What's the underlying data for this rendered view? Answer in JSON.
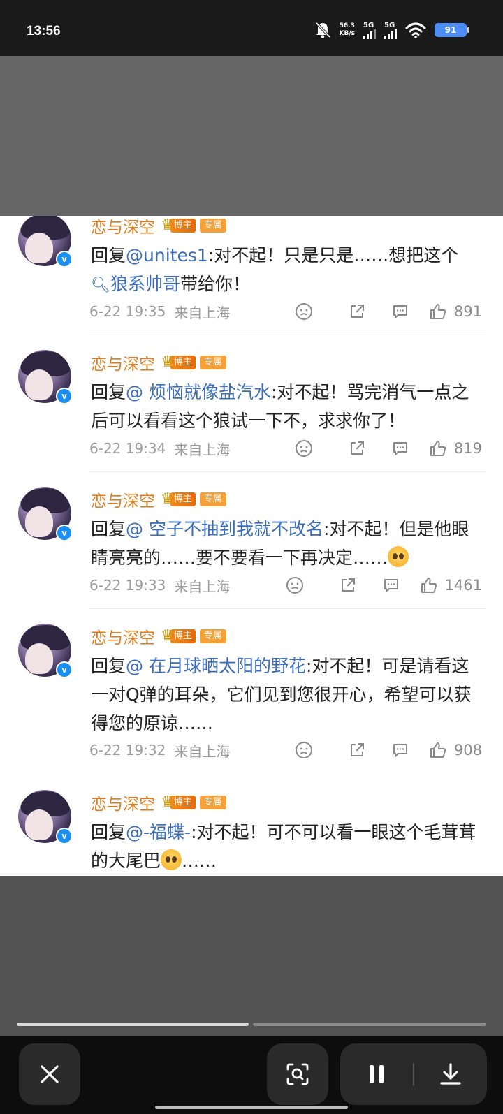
{
  "status_bar": {
    "time": "13:56",
    "net_speed_value": "56.3",
    "net_speed_unit": "KB/s",
    "sim1": "5G",
    "sim2": "5G",
    "battery": "91",
    "icons": [
      "bell-muted-icon",
      "signal-icon",
      "signal-icon",
      "wifi-icon",
      "battery-icon"
    ]
  },
  "comments": [
    {
      "username": "恋与深空",
      "badge": "博主",
      "exclusive": "专属",
      "reply_prefix": "回复",
      "mention": "@unites1",
      "text_parts": [
        ":对不起！只是只是……想把这个"
      ],
      "search_link": "狼系帅哥",
      "text_suffix": "带给你！",
      "date": "6-22 19:35",
      "source": "来自上海",
      "likes": "891"
    },
    {
      "username": "恋与深空",
      "badge": "博主",
      "exclusive": "专属",
      "reply_prefix": "回复",
      "mention": "@ 烦恼就像盐汽水",
      "text": ":对不起！骂完消气一点之后可以看看这个狼试一下不，求求你了！",
      "date": "6-22 19:34",
      "source": "来自上海",
      "likes": "819"
    },
    {
      "username": "恋与深空",
      "badge": "博主",
      "exclusive": "专属",
      "reply_prefix": "回复",
      "mention": "@ 空子不抽到我就不改名",
      "text": ":对不起！但是他眼睛亮亮的……要不要看一下再决定……",
      "date": "6-22 19:33",
      "source": "来自上海",
      "likes": "1461"
    },
    {
      "username": "恋与深空",
      "badge": "博主",
      "exclusive": "专属",
      "reply_prefix": "回复",
      "mention": "@ 在月球晒太阳的野花",
      "text": ":对不起！可是请看这一对Q弹的耳朵，它们见到您很开心，希望可以获得您的原谅……",
      "date": "6-22 19:32",
      "source": "来自上海",
      "likes": "908"
    },
    {
      "username": "恋与深空",
      "badge": "博主",
      "exclusive": "专属",
      "reply_prefix": "回复",
      "mention": "@-福蝶-",
      "text": ":对不起！可不可以看一眼这个毛茸茸的大尾巴",
      "text_suffix": "……"
    }
  ],
  "verified_mark": "v",
  "progress": {
    "current_segment": 1,
    "total_segments": 2
  }
}
